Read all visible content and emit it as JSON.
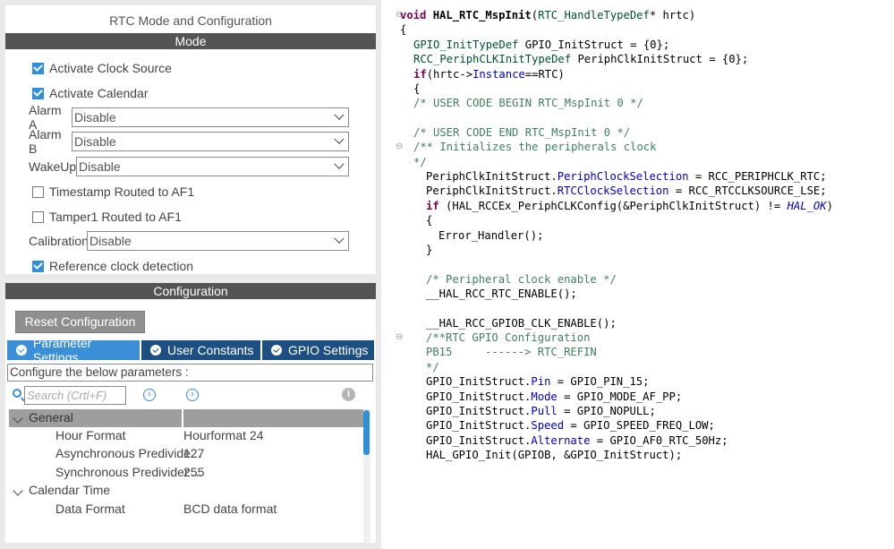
{
  "mode_panel": {
    "title": "RTC Mode and Configuration",
    "section": "Mode",
    "activate_clock_source": {
      "label": "Activate Clock Source",
      "checked": true
    },
    "activate_calendar": {
      "label": "Activate Calendar",
      "checked": true
    },
    "alarm_a": {
      "label": "Alarm A",
      "value": "Disable"
    },
    "alarm_b": {
      "label": "Alarm B",
      "value": "Disable"
    },
    "wakeup": {
      "label": "WakeUp",
      "value": "Disable"
    },
    "timestamp": {
      "label": "Timestamp Routed to AF1",
      "checked": false
    },
    "tamper1": {
      "label": "Tamper1 Routed to AF1",
      "checked": false
    },
    "calibration": {
      "label": "Calibration",
      "value": "Disable"
    },
    "reference_clock": {
      "label": "Reference clock detection",
      "checked": true
    }
  },
  "config_panel": {
    "section": "Configuration",
    "reset_button": "Reset Configuration",
    "tabs": [
      {
        "label": "Parameter Settings",
        "active": true
      },
      {
        "label": "User Constants",
        "active": false
      },
      {
        "label": "GPIO Settings",
        "active": false
      }
    ],
    "description": "Configure the below parameters :",
    "search_placeholder": "Search (Crtl+F)",
    "tree": {
      "group_general": "General",
      "rows": [
        {
          "key": "Hour Format",
          "value": "Hourformat 24"
        },
        {
          "key": "Asynchronous Predivide...",
          "value": "127"
        },
        {
          "key": "Synchronous Predivider ...",
          "value": "255"
        }
      ],
      "group_calendar": "Calendar Time",
      "calendar_rows": [
        {
          "key": "Data Format",
          "value": "BCD data format"
        }
      ]
    }
  },
  "code": {
    "l1_kw": "void",
    "l1_fn": "HAL_RTC_MspInit",
    "l1_ty": "RTC_HandleTypeDef",
    "l1_rest": "* hrtc)",
    "l2": "{",
    "l3_ty": "GPIO_InitTypeDef",
    "l3_rest": " GPIO_InitStruct = {0};",
    "l4_ty": "RCC_PeriphCLKInitTypeDef",
    "l4_rest": " PeriphClkInitStruct = {0};",
    "l5_kw": "if",
    "l5_a": "(hrtc->",
    "l5_fld": "Instance",
    "l5_b": "==RTC)",
    "l6": "{",
    "l7": "/* USER CODE BEGIN RTC_MspInit 0 */",
    "l8": "/* USER CODE END RTC_MspInit 0 */",
    "l9": "/** Initializes the peripherals clock",
    "l10": "*/",
    "l11_a": "PeriphClkInitStruct.",
    "l11_fld": "PeriphClockSelection",
    "l11_b": " = RCC_PERIPHCLK_RTC;",
    "l12_a": "PeriphClkInitStruct.",
    "l12_fld": "RTCClockSelection",
    "l12_b": " = RCC_RTCCLKSOURCE_LSE;",
    "l13_kw": "if",
    "l13_a": " (HAL_RCCEx_PeriphCLKConfig(&PeriphClkInitStruct) != ",
    "l13_it": "HAL_OK",
    "l13_b": ")",
    "l14": "{",
    "l15": "Error_Handler();",
    "l16": "}",
    "l17": "/* Peripheral clock enable */",
    "l18": "__HAL_RCC_RTC_ENABLE();",
    "l19": "__HAL_RCC_GPIOB_CLK_ENABLE();",
    "l20": "/**RTC GPIO Configuration",
    "l21": "PB15     ------> RTC_REFIN",
    "l22": "*/",
    "l23_a": "GPIO_InitStruct.",
    "l23_fld": "Pin",
    "l23_b": " = GPIO_PIN_15;",
    "l24_a": "GPIO_InitStruct.",
    "l24_fld": "Mode",
    "l24_b": " = GPIO_MODE_AF_PP;",
    "l25_a": "GPIO_InitStruct.",
    "l25_fld": "Pull",
    "l25_b": " = GPIO_NOPULL;",
    "l26_a": "GPIO_InitStruct.",
    "l26_fld": "Speed",
    "l26_b": " = GPIO_SPEED_FREQ_LOW;",
    "l27_a": "GPIO_InitStruct.",
    "l27_fld": "Alternate",
    "l27_b": " = GPIO_AF0_RTC_50Hz;",
    "l28": "HAL_GPIO_Init(GPIOB, &GPIO_InitStruct);"
  }
}
